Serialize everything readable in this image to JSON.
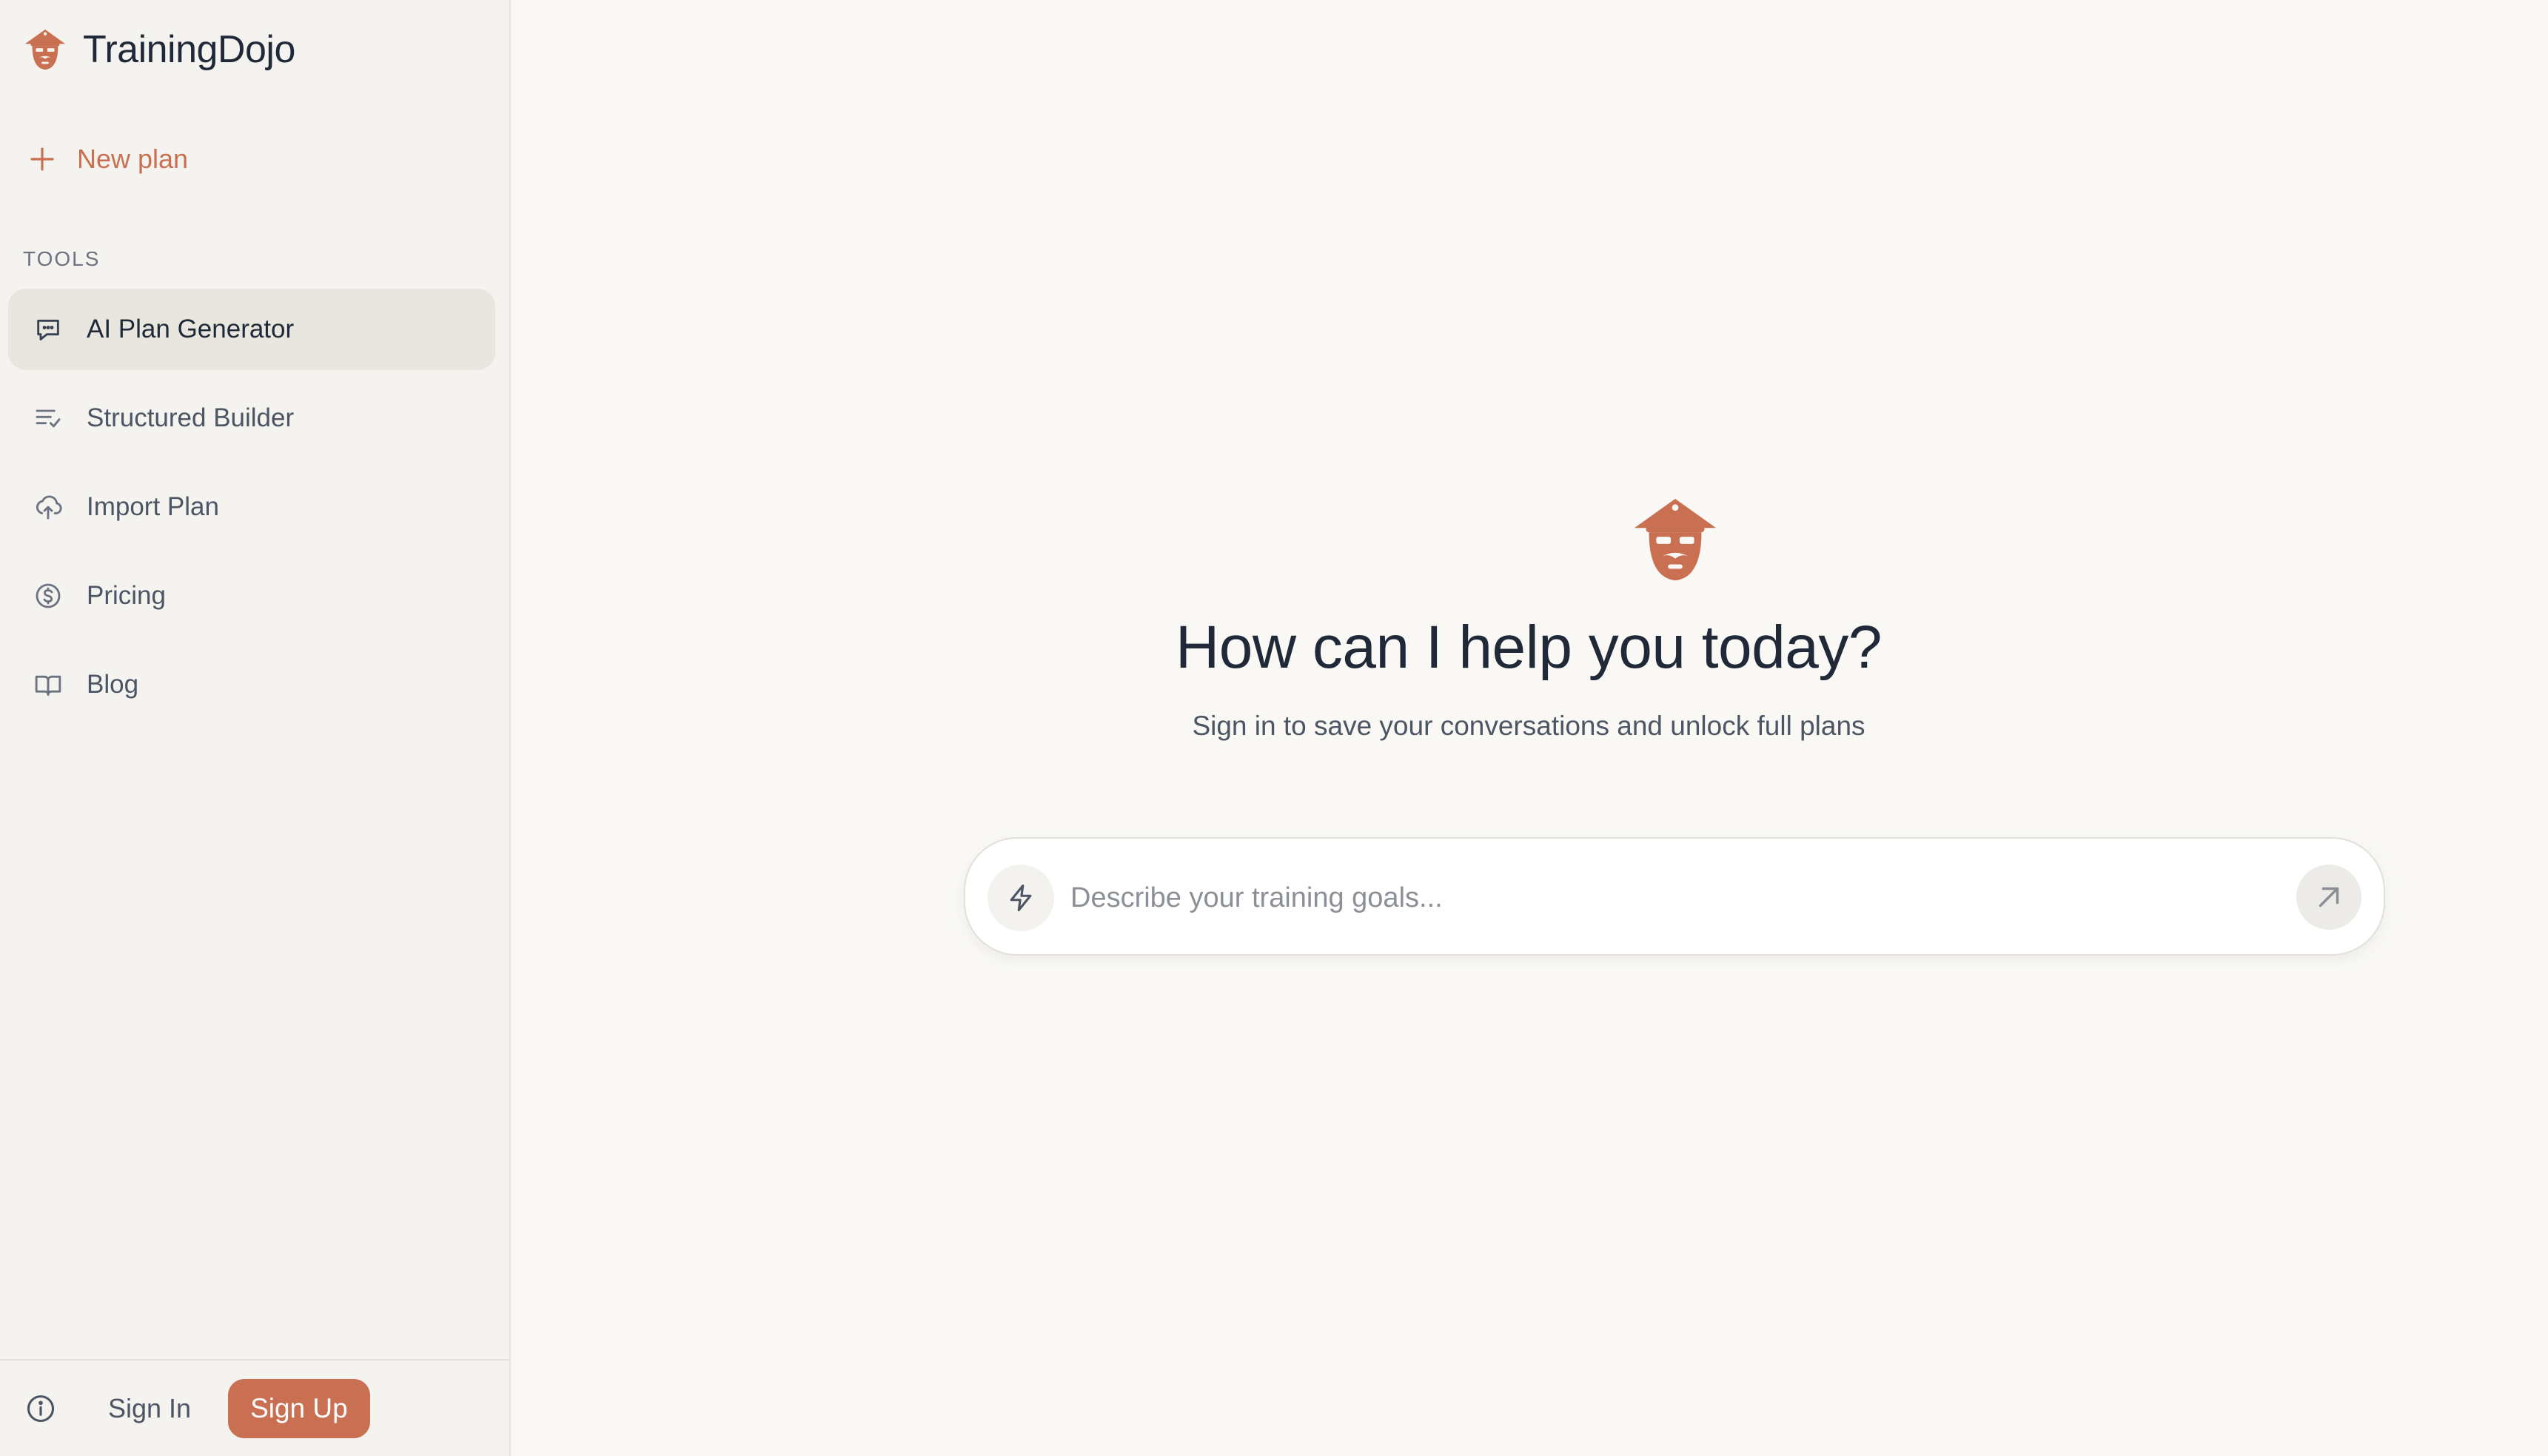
{
  "brand": {
    "name": "TrainingDojo",
    "logo_icon": "dojo-master-logo-icon",
    "accent_color": "#c96f52"
  },
  "sidebar": {
    "new_plan_label": "New plan",
    "section_label": "TOOLS",
    "items": [
      {
        "label": "AI Plan Generator",
        "icon": "chat-bubble-icon",
        "active": true
      },
      {
        "label": "Structured Builder",
        "icon": "list-check-icon",
        "active": false
      },
      {
        "label": "Import Plan",
        "icon": "cloud-upload-icon",
        "active": false
      },
      {
        "label": "Pricing",
        "icon": "dollar-circle-icon",
        "active": false
      },
      {
        "label": "Blog",
        "icon": "open-book-icon",
        "active": false
      }
    ],
    "footer": {
      "info_icon": "info-icon",
      "sign_in_label": "Sign In",
      "sign_up_label": "Sign Up"
    }
  },
  "main": {
    "title": "How can I help you today?",
    "subtitle": "Sign in to save your conversations and unlock full plans",
    "composer": {
      "placeholder": "Describe your training goals...",
      "value": "",
      "mode_icon": "lightning-icon",
      "send_icon": "arrow-up-right-icon"
    }
  }
}
